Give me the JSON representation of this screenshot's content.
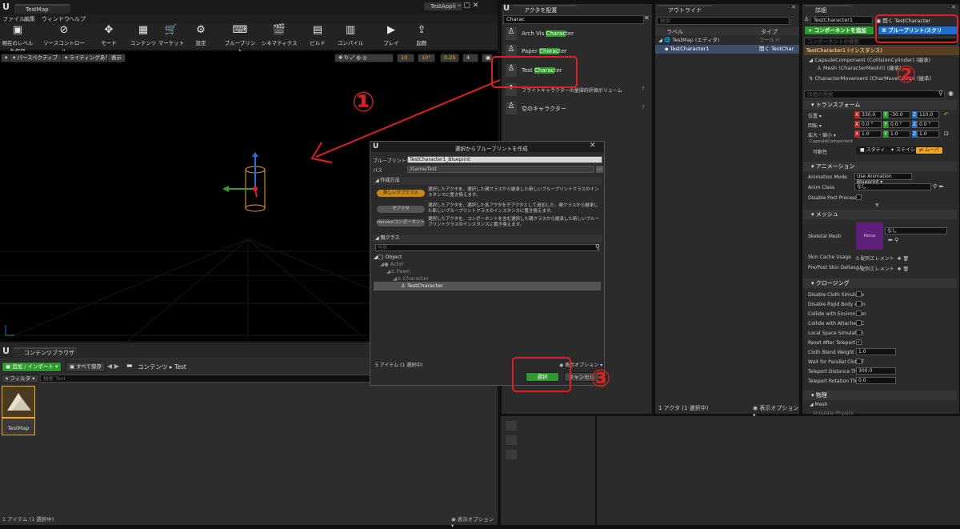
{
  "title_bar": {
    "tab1": "TestMap",
    "tab2": "TestAppli"
  },
  "menu": [
    "ファイル",
    "編集",
    "ウィンドウ",
    "ヘルプ"
  ],
  "toolbar": [
    "現在のレベルを保存",
    "ソースコントロール",
    "モード",
    "コンテンツ",
    "マーケット",
    "設定",
    "ブループリント",
    "シネマティクス",
    "ビルド",
    "コンパイル",
    "プレイ",
    "起動"
  ],
  "viewport": {
    "perspective": "パースペクティブ",
    "lighting": "ライティングあり",
    "show": "表示",
    "grid": "10",
    "angle": "10°",
    "scale": "0.25",
    "cam": "4"
  },
  "place_actors": {
    "tab": "アクタを配置",
    "search": "Charac",
    "items": [
      {
        "pre": "Arch Vis ",
        "hl": "Charac",
        "post": "ter"
      },
      {
        "pre": "Paper ",
        "hl": "Charac",
        "post": "ter"
      },
      {
        "pre": "Test ",
        "hl": "Charac",
        "post": "ter"
      },
      {
        "pre": "フラ",
        "hl": "",
        "post": "イトキャラクターの量操的評価ボリューム"
      },
      {
        "pre": "空のキャラクター",
        "hl": "",
        "post": ""
      }
    ]
  },
  "outliner": {
    "tab": "アウトライナ",
    "col_label": "ラベル",
    "col_type": "タイプ",
    "rows": [
      {
        "label": "TestMap (エディタ)",
        "type": "ワールド"
      },
      {
        "label": "TestCharacter1",
        "type": "開く TestChar"
      }
    ],
    "footer": "1 アクタ (1 選択中)",
    "view": "表示オプション"
  },
  "details": {
    "tab": "詳細",
    "name": "TestCharacter1",
    "open": "開く TestCharacter",
    "add_component": "+ コンポーネントを追加",
    "blueprint_btn": "ブループリント/スクリ",
    "search_comp": "コンポーネントの検索",
    "instance": "TestCharacter1 (インスタンス)",
    "components": [
      "CapsuleComponent (CollisionCylinder) (継承)",
      "Mesh (CharacterMesh0) (継承)",
      "CharacterMovement (CharMoveComp) (継承)"
    ],
    "search": "詳細の検索",
    "transform": "トランスフォーム",
    "loc": "位置",
    "rot": "回転",
    "scale": "拡大・縮小",
    "loc_v": [
      "330.0",
      "-30.0",
      "110.0"
    ],
    "rot_v": [
      "0.0 °",
      "0.0 °",
      "0.0 °"
    ],
    "scale_v": [
      "1.0",
      "1.0",
      "1.0"
    ],
    "capsule": "CapsuleComponent",
    "mobility": "可動性",
    "mob_opts": [
      "スタティ",
      "ステイシ",
      "ムーバ"
    ],
    "animation": "アニメーション",
    "anim_mode": "Animation Mode",
    "anim_mode_v": "Use Animation Blueprint",
    "anim_class": "Anim Class",
    "anim_class_v": "なし",
    "disable_pp": "Disable Post Process B",
    "mesh_sec": "メッシュ",
    "skel": "Skeletal Mesh",
    "none_thumb": "None",
    "none": "なし",
    "skin_cache": "Skin Cache Usage",
    "skin_cache_v": "0 配列エレメント",
    "prepost": "Pre/Post Skin Deltas U",
    "prepost_v": "0 配列エレメント",
    "cloth": "クロージング",
    "cloth_rows": [
      "Disable Cloth Simulatio",
      "Disable Rigid Body Anin",
      "Collide with Environmen",
      "Collide with Attached C",
      "Local Space Simulation",
      "Reset After Teleport",
      "Cloth Blend Weight",
      "Wait for Parallel Cloth T",
      "Teleport Distance Thre",
      "Teleport Rotation Thres"
    ],
    "cloth_blend": "1.0",
    "tele_dist": "300.0",
    "tele_rot": "0.0",
    "physics": "物理",
    "phys_mesh": "Mesh",
    "phys_sim": "Simulate Physics"
  },
  "content_browser": {
    "tab": "コンテンツブラウザ",
    "add": "追加 / インポート",
    "save": "すべて保存",
    "path1": "コンテンツ",
    "path2": "Test",
    "filter": "フィルタ",
    "search": "検索 Test",
    "item": "TestMap",
    "footer": "1 アイテム (1 選択中)",
    "view": "表示オプション"
  },
  "dialog": {
    "title": "選択からブループリントを作成",
    "bp_name_label": "ブループリント名",
    "bp_name": "TestCharacter1_Blueprint",
    "path_label": "パス",
    "path": "/Game/Test",
    "method": "作成方法",
    "options": [
      {
        "btn": "新しいサブクラス",
        "desc": "選択したアクタを、選択した親クラスから継承した新しいブループリントクラスのインスタンスに置き換えます。"
      },
      {
        "btn": "子アクタ",
        "desc": "選択したアクタを、選択した各アクタを子アクタとして追加した、親クラスから継承した新しいブループリントクラスのインスタンスに置き換えます。"
      },
      {
        "btn": "Harvestコンポーネント",
        "desc": "選択したアクタを、コンポーネントを含む選択した親クラスから継承した新しいブループリントクラスのインスタンスに置き換えます。"
      }
    ],
    "parent": "親クラス",
    "search": "検索",
    "tree": [
      "Object",
      "Actor",
      "Pawn",
      "Character",
      "TestCharacter"
    ],
    "count": "5 アイテム (1 選択中)",
    "view": "表示オプション",
    "select": "選択",
    "cancel": "キャンセル"
  },
  "annotations": [
    "①",
    "②",
    "③"
  ],
  "colors": {
    "red": "#e02020",
    "accent": "#f2a71a",
    "green": "#2c9a2c",
    "blue": "#1d6fd1"
  }
}
